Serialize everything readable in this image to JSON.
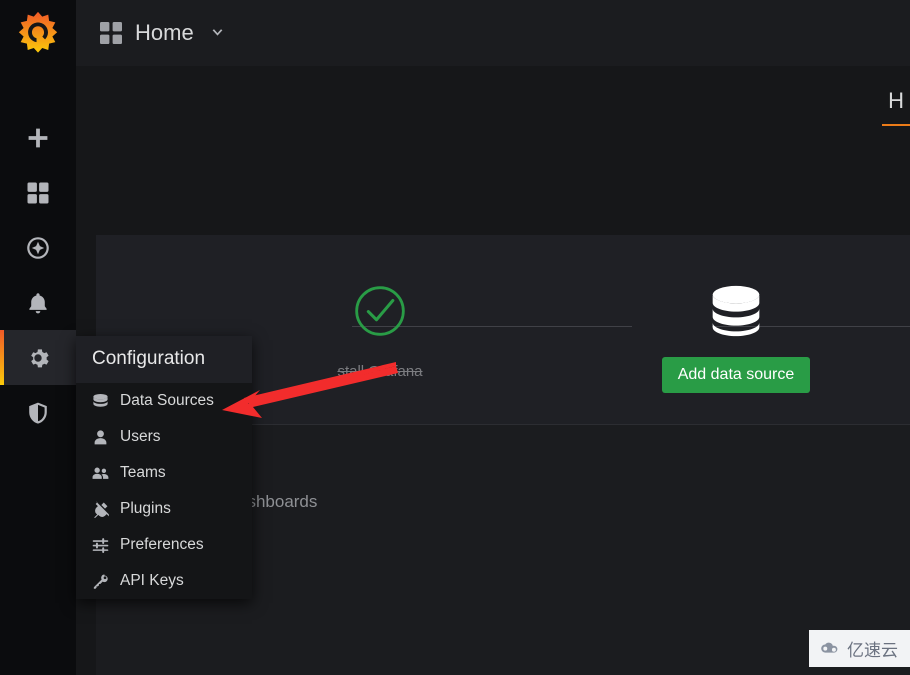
{
  "app": {
    "name": "Grafana",
    "logo_icon": "grafana-logo-icon"
  },
  "breadcrumb": {
    "grid_icon": "dashboard-grid-icon",
    "label": "Home",
    "chevron_icon": "chevron-down-icon"
  },
  "tabs": [
    {
      "label": "H",
      "icon": "",
      "active": true
    }
  ],
  "sidebar": {
    "items": [
      {
        "icon": "plus-icon",
        "name": "create",
        "active": false
      },
      {
        "icon": "grid-icon",
        "name": "dashboards",
        "active": false
      },
      {
        "icon": "compass-icon",
        "name": "explore",
        "active": false
      },
      {
        "icon": "bell-icon",
        "name": "alerting",
        "active": false
      },
      {
        "icon": "gear-icon",
        "name": "configuration",
        "active": true
      },
      {
        "icon": "shield-icon",
        "name": "server-admin",
        "active": false
      }
    ]
  },
  "configuration_menu": {
    "title": "Configuration",
    "items": [
      {
        "label": "Data Sources",
        "icon": "database-icon"
      },
      {
        "label": "Users",
        "icon": "user-icon"
      },
      {
        "label": "Teams",
        "icon": "users-icon"
      },
      {
        "label": "Plugins",
        "icon": "plug-icon"
      },
      {
        "label": "Preferences",
        "icon": "sliders-icon"
      },
      {
        "label": "API Keys",
        "icon": "key-icon"
      }
    ]
  },
  "getting_started": {
    "steps": [
      {
        "icon": "check-circle-icon",
        "label": "stall Grafana",
        "completed": true,
        "action": null
      },
      {
        "icon": "database-icon",
        "label": "",
        "completed": false,
        "action": "Add data source"
      }
    ]
  },
  "obscured_text": [
    {
      "text": "s"
    },
    {
      "text": "ashboards"
    }
  ],
  "watermark": {
    "text": "亿速云",
    "icon": "cloud-icon"
  },
  "colors": {
    "page_background": "#161719",
    "rail_background": "#0b0c0e",
    "panel_background": "#1f2025",
    "accent_orange": "#eb7b18",
    "accent_gradient_start": "#f05a28",
    "accent_gradient_end": "#fbca0a",
    "green_button": "#299c46",
    "green_check": "#299c46",
    "annotation_red": "#f22c2c",
    "text_primary": "#d8d9da",
    "text_muted": "#7b7c80"
  }
}
